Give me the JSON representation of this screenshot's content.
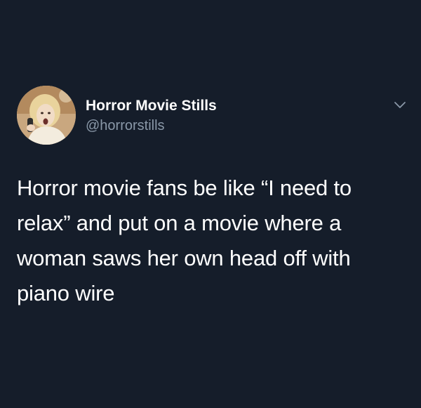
{
  "tweet": {
    "author": {
      "display_name": "Horror Movie Stills",
      "handle": "@horrorstills",
      "avatar_icon": "profile-photo"
    },
    "text": "Horror movie fans be like “I need to relax” and put on a movie where a woman saws her own head off with piano wire",
    "menu_icon": "chevron-down-icon"
  },
  "colors": {
    "background": "#151d2a",
    "text_primary": "#ffffff",
    "text_secondary": "#8a98a8"
  }
}
